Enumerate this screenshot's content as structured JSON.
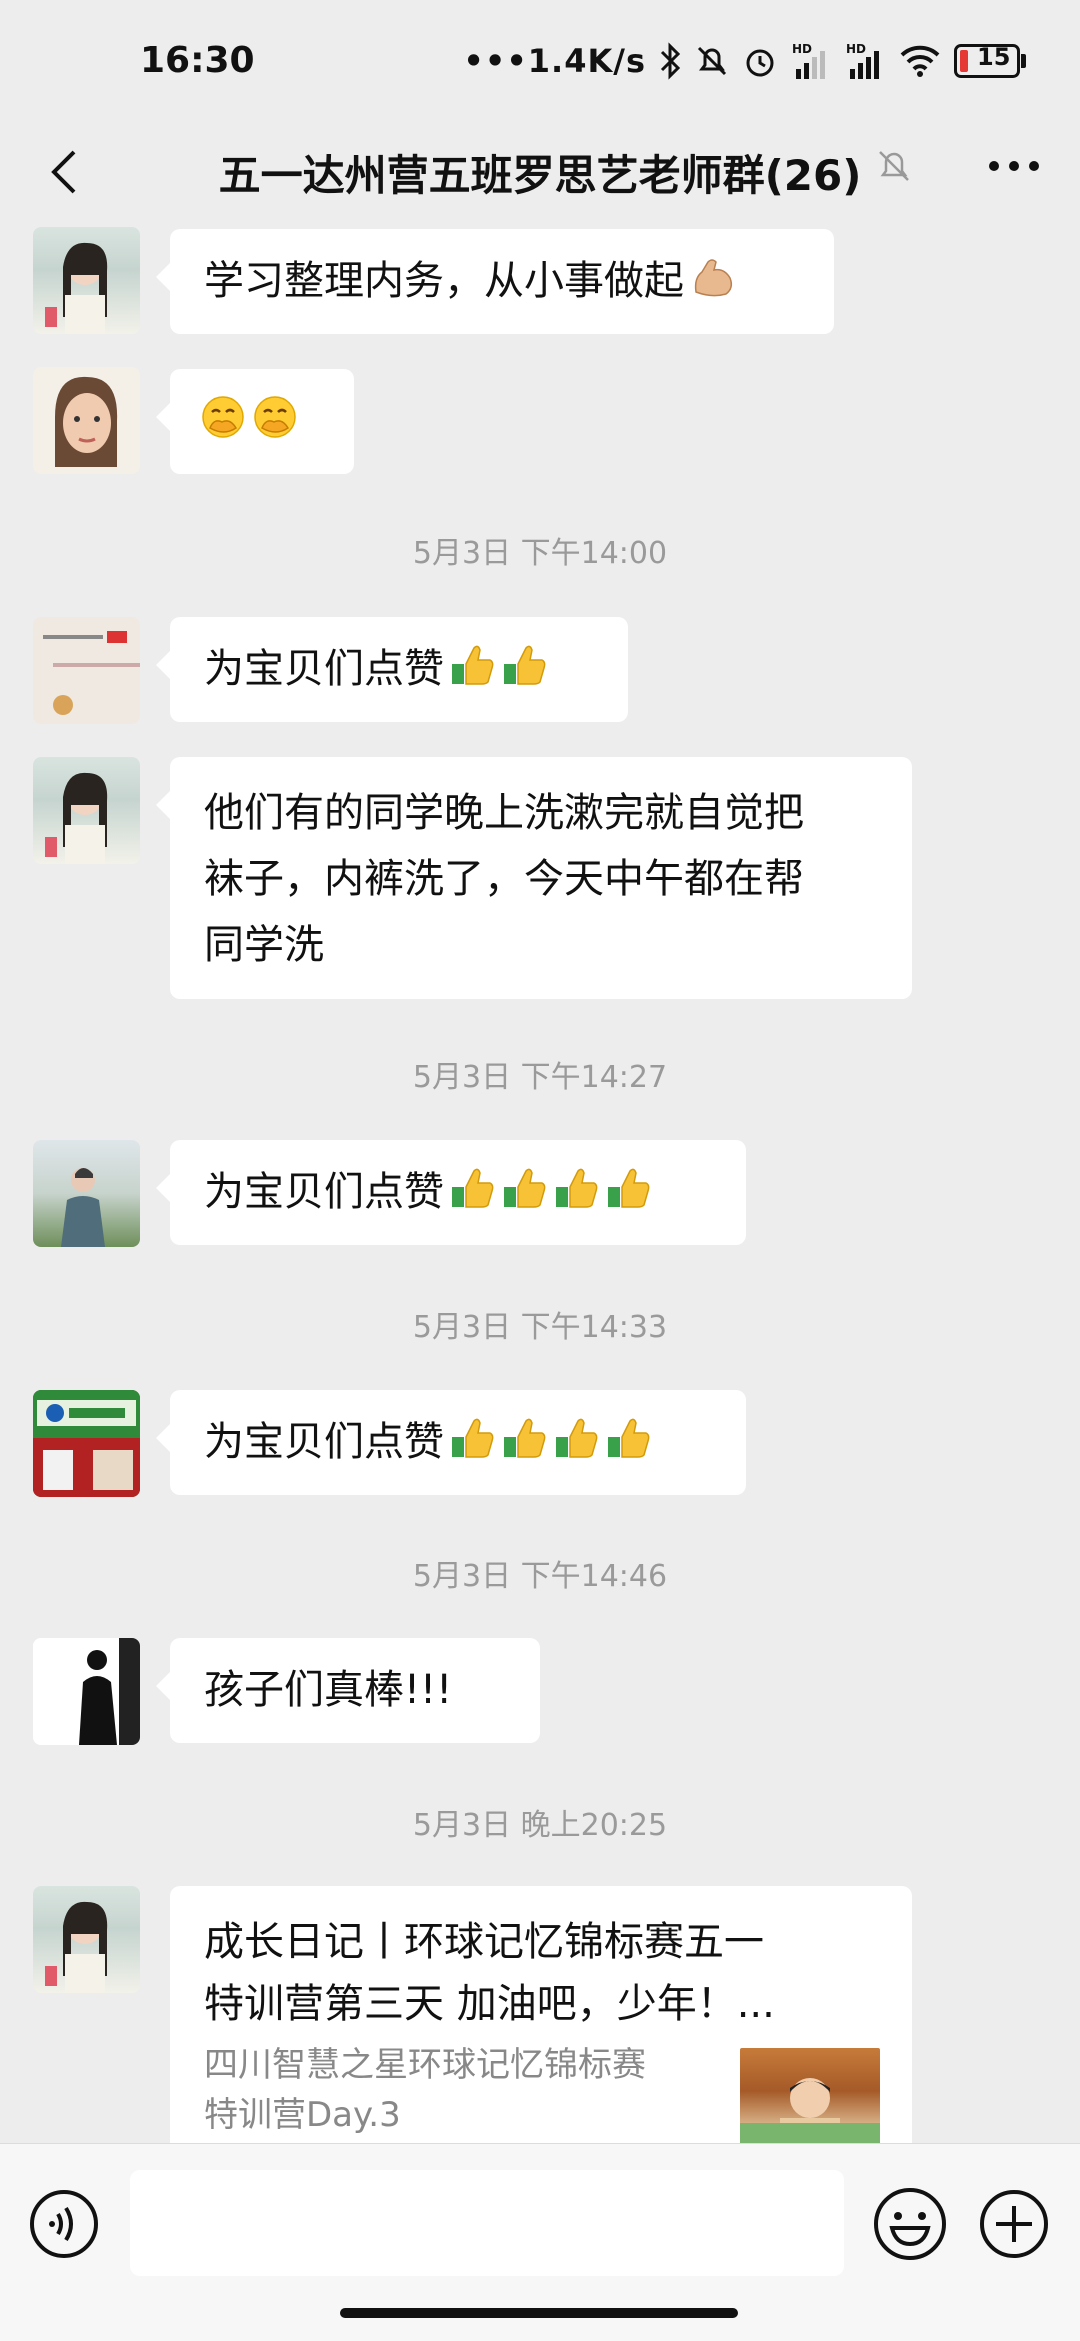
{
  "status_bar": {
    "time": "16:30",
    "network_speed": "1.4K/s",
    "signal_label": "HD",
    "battery": "15"
  },
  "header": {
    "title": "五一达州营五班罗思艺老师群(26)"
  },
  "messages": [
    {
      "type": "text",
      "text": "学习整理内务，从小事做起",
      "emoji": [
        "flexed-biceps-icon"
      ]
    },
    {
      "type": "text",
      "text": "",
      "emoji": [
        "face-with-hand-over-mouth-icon",
        "face-with-hand-over-mouth-icon"
      ]
    },
    {
      "type": "timestamp",
      "text": "5月3日 下午14:00"
    },
    {
      "type": "text",
      "text": "为宝贝们点赞",
      "emoji": [
        "thumbs-up-icon",
        "thumbs-up-icon"
      ]
    },
    {
      "type": "text",
      "lines": [
        "他们有的同学晚上洗漱完就自觉把",
        "袜子，内裤洗了，今天中午都在帮",
        "同学洗"
      ]
    },
    {
      "type": "timestamp",
      "text": "5月3日 下午14:27"
    },
    {
      "type": "text",
      "text": "为宝贝们点赞",
      "emoji": [
        "thumbs-up-icon",
        "thumbs-up-icon",
        "thumbs-up-icon",
        "thumbs-up-icon"
      ]
    },
    {
      "type": "timestamp",
      "text": "5月3日 下午14:33"
    },
    {
      "type": "text",
      "text": "为宝贝们点赞",
      "emoji": [
        "thumbs-up-icon",
        "thumbs-up-icon",
        "thumbs-up-icon",
        "thumbs-up-icon"
      ]
    },
    {
      "type": "timestamp",
      "text": "5月3日 下午14:46"
    },
    {
      "type": "text",
      "text": "孩子们真棒!!!"
    },
    {
      "type": "timestamp",
      "text": "5月3日 晚上20:25"
    },
    {
      "type": "card",
      "title_lines": [
        "成长日记丨环球记忆锦标赛五一",
        "特训营第三天 加油吧，少年！..."
      ],
      "desc_lines": [
        "四川智慧之星环球记忆锦标赛",
        "特训营Day.3"
      ]
    }
  ],
  "colors": {
    "background": "#ededed",
    "bubble": "#ffffff",
    "timestamp": "#9a9a9a",
    "bottom_bar": "#f7f7f7"
  }
}
